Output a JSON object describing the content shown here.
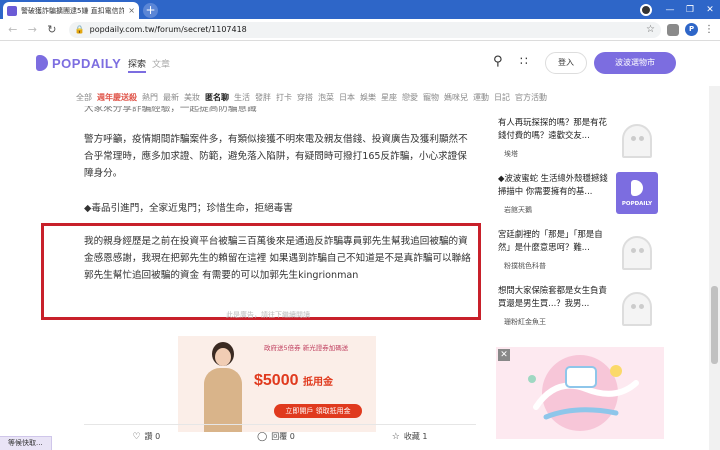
{
  "browser": {
    "tab_title": "警破獲詐騙擴團逮5嫌 直扣電信詐...",
    "tab_close": "×",
    "new_tab": "+",
    "url": "popdaily.com.tw/forum/secret/1107418",
    "profile_initial": "P",
    "window_controls": [
      "—",
      "❐",
      "✕"
    ],
    "status_text": "等候快取..."
  },
  "site": {
    "logo": "POPDAILY",
    "nav_explore": "探索",
    "nav_article": "文章",
    "login": "登入",
    "shop": "波波選物市",
    "categories": [
      "全部",
      "週年慶送殺",
      "熱門",
      "最新",
      "美妝",
      "匿名聊",
      "生活",
      "發胖",
      "打卡",
      "穿搭",
      "泡菜",
      "日本",
      "娛樂",
      "星座",
      "戀愛",
      "寵物",
      "媽咪兒",
      "運動",
      "日記",
      "官方活動"
    ]
  },
  "article": {
    "cut_line": "大家來分享詐騙經驗，一起提高防騙意識",
    "para1": "警方呼籲，疫情期間詐騙案件多，有類似接獲不明來電及親友借錢、投資廣告及獲利顯然不合乎常理時，應多加求證、防範，避免落入陷阱，有疑問時可撥打165反詐騙，小心求證保障身分。",
    "para2": "◆毒品引進門，全家近鬼門；珍惜生命，拒絕毒害",
    "highlighted": "我的親身經歷是之前在投資平台被騙三百萬後來是通過反詐騙專員郭先生幫我追回被騙的資金感恩感謝，我現在把郭先生的賴留在這裡 如果遇到詐騙自己不知道是不是真詐騙可以聯絡郭先生幫忙追回被騙的資金 有需要的可以加郭先生kingrionman",
    "hidden_hint": "此是廣告，請往下繼續閱讀",
    "like": "讚 0",
    "comment": "回覆 0",
    "save": "收藏 1"
  },
  "ad": {
    "tagline": "政府送5倍券 新光證券加碼送",
    "amount": "$5000",
    "amount_sub": "抵用金",
    "cta": "立即開戶 領取抵用金"
  },
  "sidebar": [
    {
      "title": "有人再玩探探的嗎？那是有花錢付費的嗎？遠歡交友...",
      "author": "埃塔",
      "thumb": "ghost"
    },
    {
      "title": "◆波波蜜蛇 生活總外殼穩撼錢掃描中 你需要擁有的基...",
      "author": "岩館天鵝",
      "thumb": "brand"
    },
    {
      "title": "宮廷劇裡的「那是」「那是自然」是什麼意思呵？難...",
      "author": "粉撲桃色科普",
      "thumb": "ghost"
    },
    {
      "title": "想問大家保險套都是女生負責買還是男生買...？我男...",
      "author": "珊粉紅金魚王",
      "thumb": "ghost"
    }
  ],
  "sidebar_brand": "POPDAILY",
  "sidebar_ad_close": "✕"
}
